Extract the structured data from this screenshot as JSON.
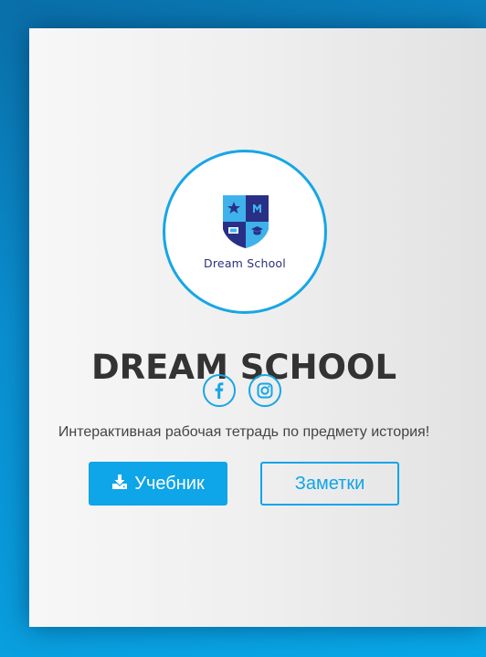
{
  "logo": {
    "text": "Dream School"
  },
  "title": "DREAM SCHOOL",
  "social": {
    "facebook_icon": "facebook-icon",
    "instagram_icon": "instagram-icon"
  },
  "tagline": "Интерактивная рабочая тетрадь по предмету история!",
  "buttons": {
    "primary_label": "Учебник",
    "primary_icon": "download-icon",
    "secondary_label": "Заметки"
  },
  "colors": {
    "accent": "#0ea5e9",
    "title": "#333333",
    "background": "#0a8fd0"
  }
}
